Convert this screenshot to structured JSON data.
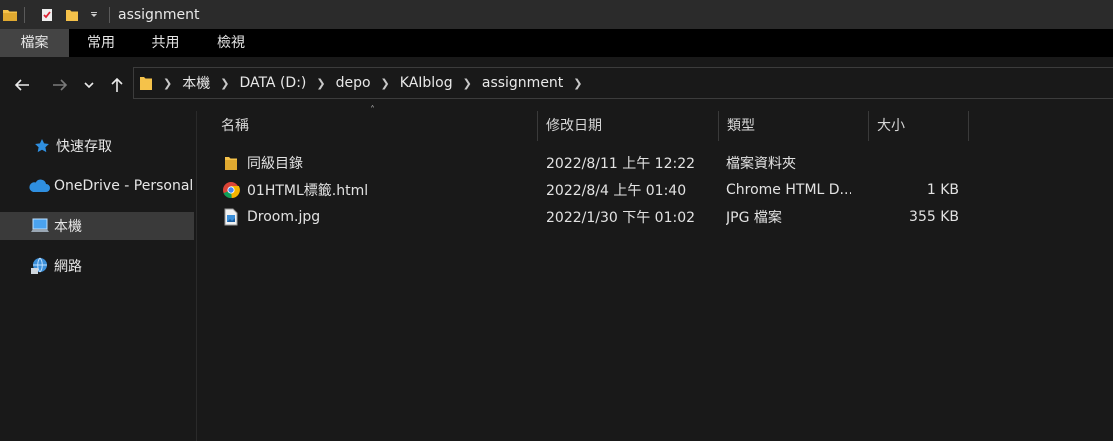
{
  "window": {
    "title": "assignment"
  },
  "ribbon": {
    "tabs": [
      "檔案",
      "常用",
      "共用",
      "檢視"
    ]
  },
  "address": {
    "crumbs": [
      "本機",
      "DATA (D:)",
      "depo",
      "KAIblog",
      "assignment"
    ]
  },
  "sidebar": {
    "items": [
      {
        "label": "快速存取",
        "icon": "star-icon"
      },
      {
        "label": "OneDrive - Personal",
        "icon": "cloud-icon"
      },
      {
        "label": "本機",
        "icon": "computer-icon"
      },
      {
        "label": "網路",
        "icon": "network-icon"
      }
    ]
  },
  "columns": {
    "name": "名稱",
    "date": "修改日期",
    "type": "類型",
    "size": "大小"
  },
  "files": [
    {
      "name": "同級目錄",
      "date": "2022/8/11 上午 12:22",
      "type": "檔案資料夾",
      "size": "",
      "icon": "folder-icon"
    },
    {
      "name": "01HTML標籤.html",
      "date": "2022/8/4 上午 01:40",
      "type": "Chrome HTML D...",
      "size": "1 KB",
      "icon": "chrome-icon"
    },
    {
      "name": "Droom.jpg",
      "date": "2022/1/30 下午 01:02",
      "type": "JPG 檔案",
      "size": "355 KB",
      "icon": "image-file-icon"
    }
  ],
  "colors": {
    "folder": "#f5c24a",
    "accent_blue": "#2f8fe0",
    "selected": "#3a3a3a"
  }
}
